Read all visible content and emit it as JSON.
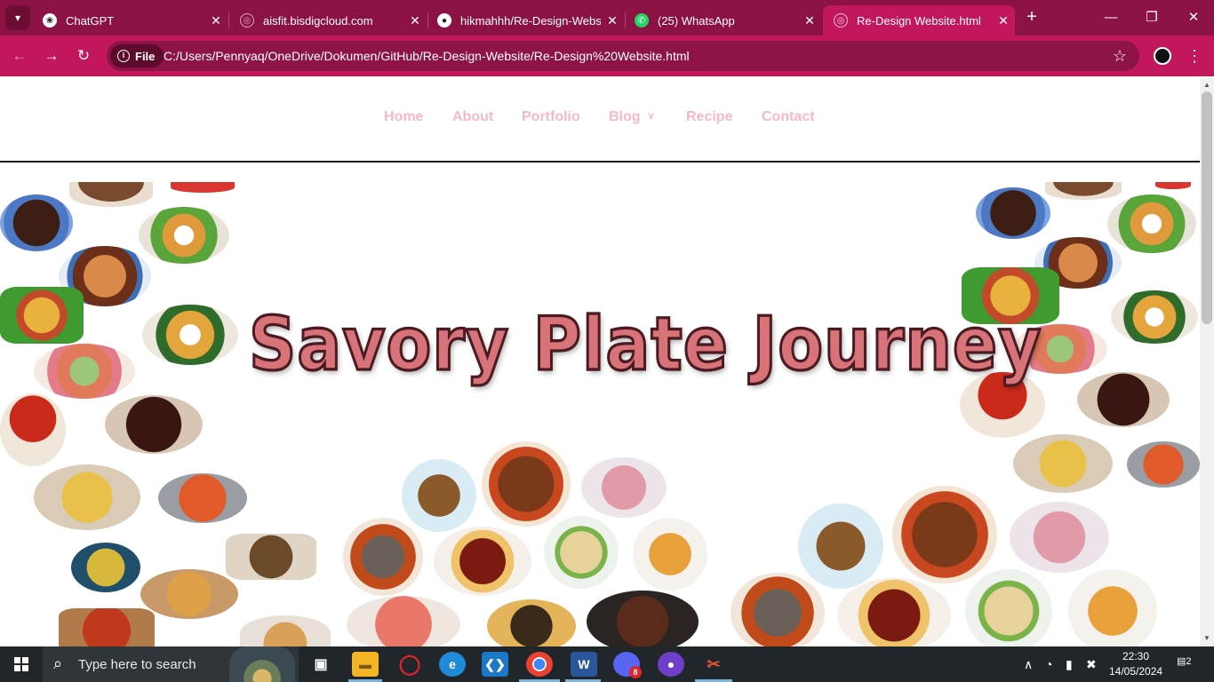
{
  "browser": {
    "tabs": [
      {
        "title": "ChatGPT",
        "icon": "chatgpt-icon",
        "active": false
      },
      {
        "title": "aisfit.bisdigcloud.com",
        "icon": "globe-icon",
        "active": false
      },
      {
        "title": "hikmahhh/Re-Design-Websi",
        "icon": "github-icon",
        "active": false
      },
      {
        "title": "(25) WhatsApp",
        "icon": "whatsapp-icon",
        "active": false
      },
      {
        "title": "Re-Design Website.html",
        "icon": "globe-icon",
        "active": true
      }
    ],
    "chip_label": "File",
    "url": "C:/Users/Pennyaq/OneDrive/Dokumen/GitHub/Re-Design-Website/Re-Design%20Website.html",
    "accent": "#c2185b",
    "tabbar_color": "#8b1243"
  },
  "site": {
    "nav": [
      {
        "label": "Home"
      },
      {
        "label": "About"
      },
      {
        "label": "Portfolio"
      },
      {
        "label": "Blog",
        "dropdown": true
      },
      {
        "label": "Recipe"
      },
      {
        "label": "Contact"
      }
    ],
    "nav_color": "#f5b8c8",
    "hero_title": "Savory Plate Journey",
    "hero_title_color": "#d9737a"
  },
  "taskbar": {
    "search_placeholder": "Type here to search",
    "apps": [
      "task-view-icon",
      "file-explorer-icon",
      "opera-icon",
      "edge-icon",
      "vscode-icon",
      "chrome-icon",
      "word-icon",
      "discord-icon",
      "github-desktop-icon",
      "snipping-tool-icon"
    ],
    "discord_badge": "8",
    "time": "22:30",
    "date": "14/05/2024",
    "notification_count": "2"
  }
}
